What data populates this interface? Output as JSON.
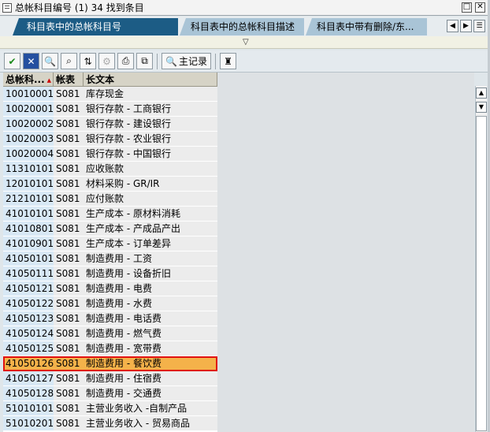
{
  "window": {
    "title": "总帐科目编号 (1)  34 找到条目"
  },
  "tabs": [
    {
      "label": "科目表中的总帐科目号"
    },
    {
      "label": "科目表中的总帐科目描述"
    },
    {
      "label": "科目表中带有删除/东..."
    }
  ],
  "toolbar": {
    "record_label": "主记录"
  },
  "table": {
    "columns": [
      "总帐科...",
      "帐表",
      "长文本"
    ],
    "rows": [
      {
        "gl": "10010001",
        "coa": "S081",
        "text": "库存现金"
      },
      {
        "gl": "10020001",
        "coa": "S081",
        "text": "银行存款 - 工商银行"
      },
      {
        "gl": "10020002",
        "coa": "S081",
        "text": "银行存款 - 建设银行"
      },
      {
        "gl": "10020003",
        "coa": "S081",
        "text": "银行存款 - 农业银行"
      },
      {
        "gl": "10020004",
        "coa": "S081",
        "text": "银行存款 - 中国银行"
      },
      {
        "gl": "11310101",
        "coa": "S081",
        "text": "应收账款"
      },
      {
        "gl": "12010101",
        "coa": "S081",
        "text": "材料采购 - GR/IR"
      },
      {
        "gl": "21210101",
        "coa": "S081",
        "text": "应付账款"
      },
      {
        "gl": "41010101",
        "coa": "S081",
        "text": "生产成本 - 原材料消耗"
      },
      {
        "gl": "41010801",
        "coa": "S081",
        "text": "生产成本 - 产成品产出"
      },
      {
        "gl": "41010901",
        "coa": "S081",
        "text": "生产成本 - 订单差异"
      },
      {
        "gl": "41050101",
        "coa": "S081",
        "text": "制造费用 - 工资"
      },
      {
        "gl": "41050111",
        "coa": "S081",
        "text": "制造费用 - 设备折旧"
      },
      {
        "gl": "41050121",
        "coa": "S081",
        "text": "制造费用 - 电费"
      },
      {
        "gl": "41050122",
        "coa": "S081",
        "text": "制造费用 - 水费"
      },
      {
        "gl": "41050123",
        "coa": "S081",
        "text": "制造费用 - 电话费"
      },
      {
        "gl": "41050124",
        "coa": "S081",
        "text": "制造费用 - 燃气费"
      },
      {
        "gl": "41050125",
        "coa": "S081",
        "text": "制造费用 - 宽带费"
      },
      {
        "gl": "41050126",
        "coa": "S081",
        "text": "制造费用 - 餐饮费",
        "selected": true
      },
      {
        "gl": "41050127",
        "coa": "S081",
        "text": "制造费用 - 住宿费"
      },
      {
        "gl": "41050128",
        "coa": "S081",
        "text": "制造费用 - 交通费"
      },
      {
        "gl": "51010101",
        "coa": "S081",
        "text": "主营业务收入 -自制产品"
      },
      {
        "gl": "51010201",
        "coa": "S081",
        "text": "主营业务收入 - 贸易商品"
      }
    ]
  },
  "colors": {
    "active_tab": "#1c5c85",
    "inactive_tab": "#a9c4d6",
    "selected_row": "#f4b24a",
    "selection_border": "#e01010"
  }
}
